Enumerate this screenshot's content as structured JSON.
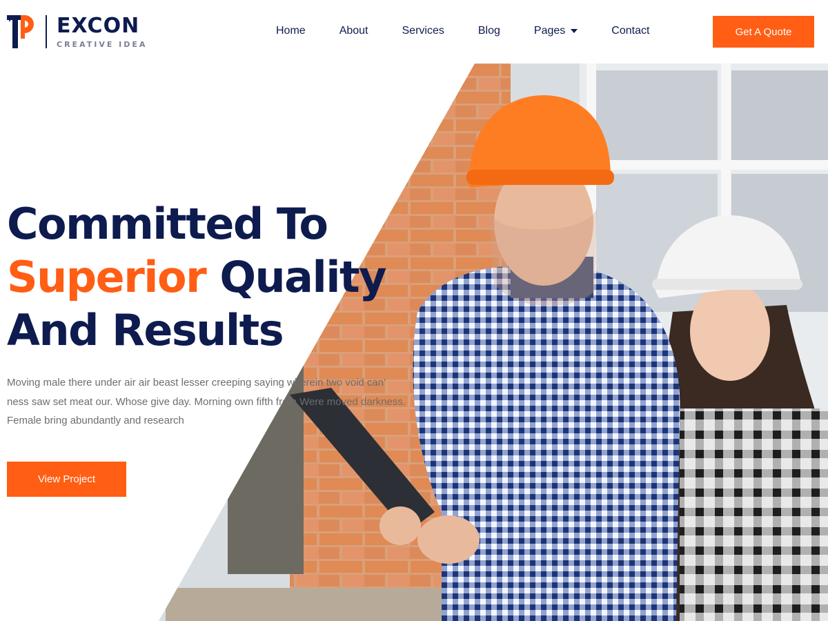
{
  "brand": {
    "name": "EXCON",
    "tagline": "CREATIVE IDEA",
    "logo_icon": "tp-monogram-icon",
    "colors": {
      "primary": "#0d1b4f",
      "accent": "#ff5e14"
    }
  },
  "nav": {
    "items": [
      {
        "label": "Home"
      },
      {
        "label": "About"
      },
      {
        "label": "Services"
      },
      {
        "label": "Blog"
      },
      {
        "label": "Pages",
        "icon": "chevron-down-icon"
      },
      {
        "label": "Contact"
      }
    ],
    "cta_label": "Get A Quote"
  },
  "hero": {
    "title_line1": "Committed To",
    "title_accent": "Superior",
    "title_line2_rest": " Quality",
    "title_line3": "And Results",
    "description": "Moving male there under air air beast lesser creeping saying wherein two void can' ness saw set meat our. Whose give day. Morning own fifth from Were moved darkness. Female bring abundantly and research",
    "button_label": "View Project",
    "image": "construction-workers-photo"
  }
}
